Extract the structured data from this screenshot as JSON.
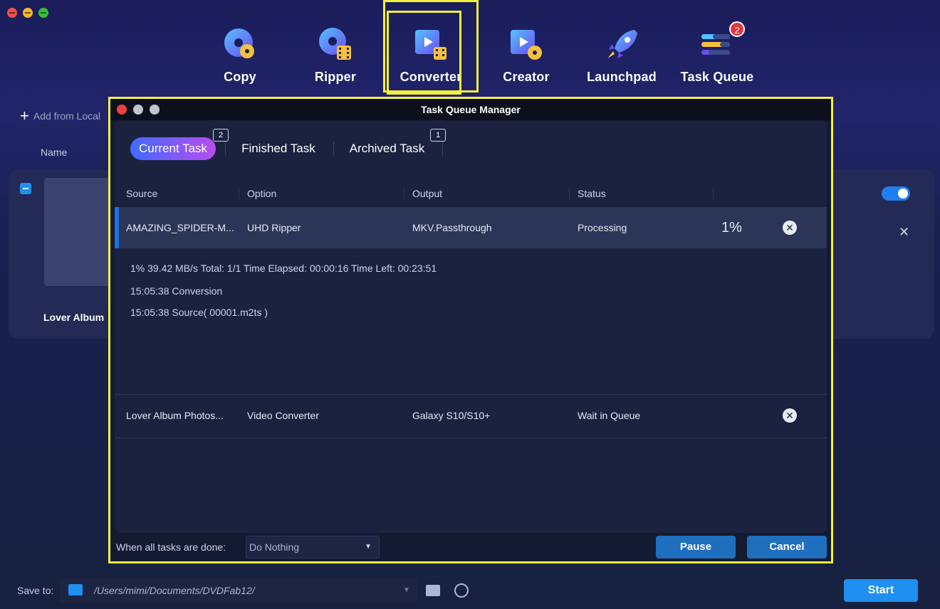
{
  "toolbar": {
    "items": [
      {
        "label": "Copy",
        "icon": "copy-disc-icon"
      },
      {
        "label": "Ripper",
        "icon": "ripper-disc-icon"
      },
      {
        "label": "Converter",
        "icon": "converter-film-icon"
      },
      {
        "label": "Creator",
        "icon": "creator-film-icon"
      },
      {
        "label": "Launchpad",
        "icon": "rocket-icon"
      },
      {
        "label": "Task Queue",
        "icon": "task-queue-icon"
      }
    ],
    "active": "Converter",
    "task_queue_badge": "2"
  },
  "background": {
    "add_from_local": "Add from Local",
    "name_header": "Name",
    "item_label": "Lover Album"
  },
  "modal": {
    "title": "Task Queue Manager",
    "tabs": [
      {
        "label": "Current Task",
        "badge": "2"
      },
      {
        "label": "Finished Task",
        "badge": ""
      },
      {
        "label": "Archived Task",
        "badge": "1"
      }
    ],
    "columns": [
      "Source",
      "Option",
      "Output",
      "Status"
    ],
    "rows": [
      {
        "source": "AMAZING_SPIDER-M...",
        "option": "UHD Ripper",
        "output": "MKV.Passthrough",
        "status": "Processing",
        "progress": "1%"
      },
      {
        "source": "Lover Album Photos...",
        "option": "Video Converter",
        "output": "Galaxy S10/S10+",
        "status": "Wait in Queue",
        "progress": ""
      }
    ],
    "details": {
      "summary": "1%  39.42 MB/s   Total: 1/1   Time Elapsed: 00:00:16   Time Left: 00:23:51",
      "log1": "15:05:38  Conversion",
      "log2": "15:05:38  Source( 00001.m2ts )"
    },
    "footer": {
      "label": "When all tasks are done:",
      "select_value": "Do Nothing",
      "pause": "Pause",
      "cancel": "Cancel"
    }
  },
  "bottom": {
    "save_to": "Save to:",
    "path": "/Users/mimi/Documents/DVDFab12/",
    "start": "Start"
  },
  "colors": {
    "accent": "#1f8ff0",
    "highlight": "#f4ef3c",
    "badge": "#e2363d"
  }
}
